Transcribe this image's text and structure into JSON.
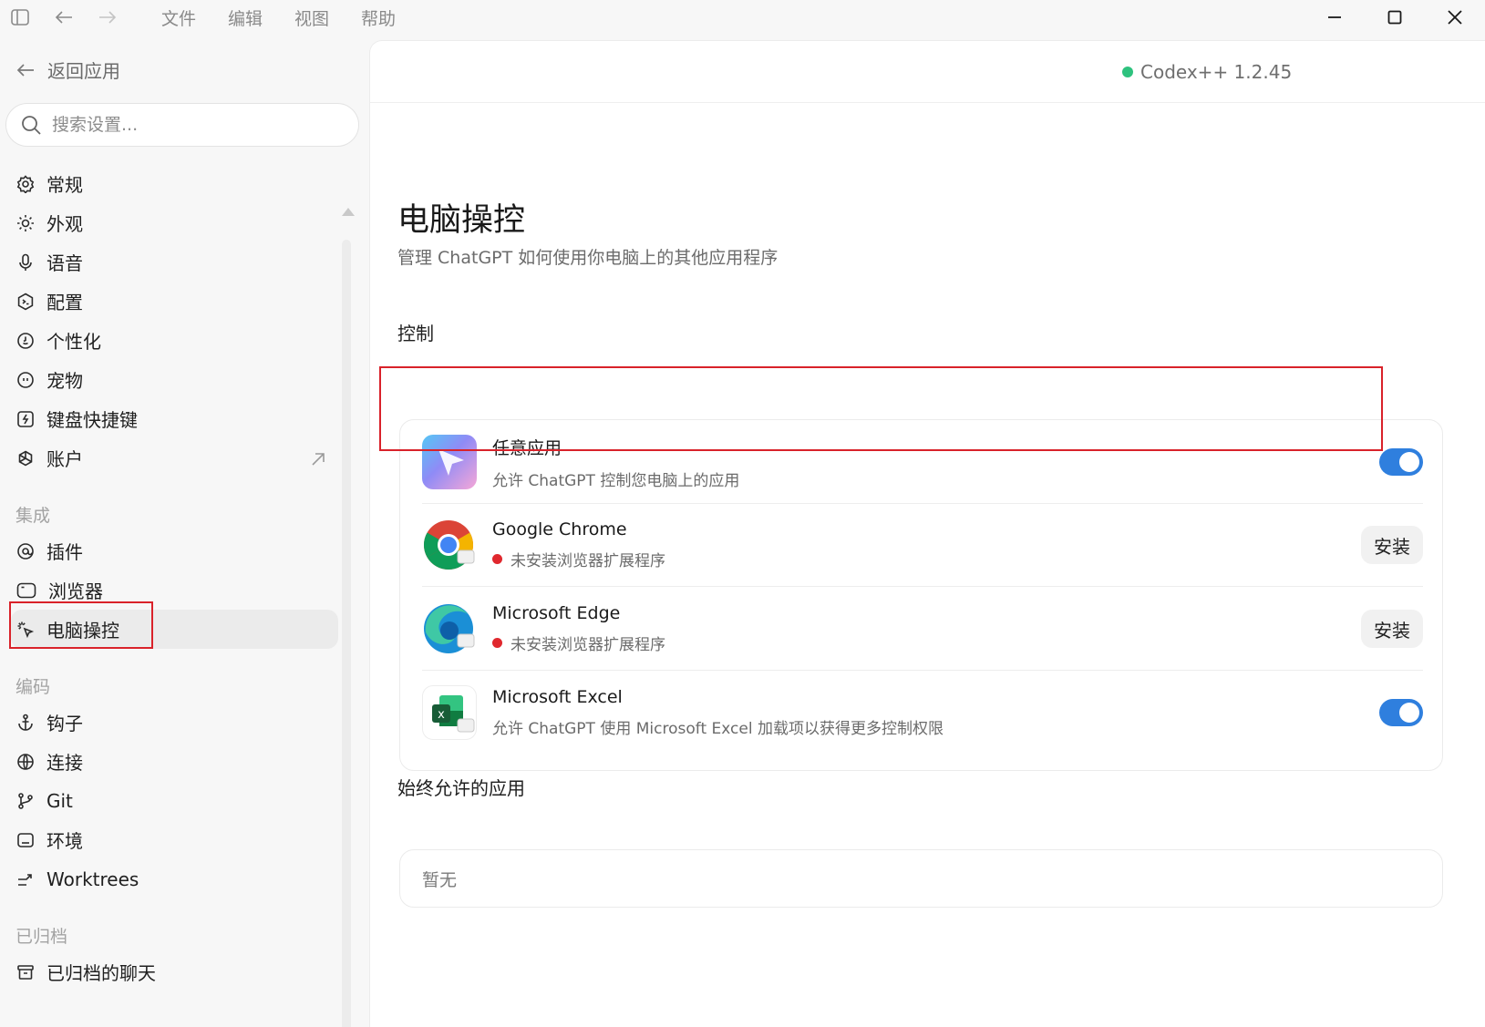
{
  "menu": {
    "items": [
      "文件",
      "编辑",
      "视图",
      "帮助"
    ]
  },
  "sidebar": {
    "back_label": "返回应用",
    "search_placeholder": "搜索设置...",
    "general": [
      {
        "label": "常规",
        "icon": "gear-icon"
      },
      {
        "label": "外观",
        "icon": "sun-icon"
      },
      {
        "label": "语音",
        "icon": "microphone-icon"
      },
      {
        "label": "配置",
        "icon": "terminal-hexagon-icon"
      },
      {
        "label": "个性化",
        "icon": "personalization-icon"
      },
      {
        "label": "宠物",
        "icon": "pet-icon"
      },
      {
        "label": "键盘快捷键",
        "icon": "keyboard-shortcut-icon"
      },
      {
        "label": "账户",
        "icon": "openai-logo-icon"
      }
    ],
    "integration_label": "集成",
    "integration": [
      {
        "label": "插件",
        "icon": "plugin-icon"
      },
      {
        "label": "浏览器",
        "icon": "browser-icon"
      },
      {
        "label": "电脑操控",
        "icon": "cursor-click-icon"
      }
    ],
    "coding_label": "编码",
    "coding": [
      {
        "label": "钩子",
        "icon": "anchor-icon"
      },
      {
        "label": "连接",
        "icon": "globe-icon"
      },
      {
        "label": "Git",
        "icon": "git-branch-icon"
      },
      {
        "label": "环境",
        "icon": "environment-icon"
      },
      {
        "label": "Worktrees",
        "icon": "worktree-icon"
      }
    ],
    "archived_label": "已归档",
    "archived": [
      {
        "label": "已归档的聊天",
        "icon": "archive-icon"
      }
    ]
  },
  "header": {
    "version": "Codex++ 1.2.45"
  },
  "page": {
    "title": "电脑操控",
    "subtitle": "管理 ChatGPT 如何使用你电脑上的其他应用程序",
    "control_title": "控制",
    "apps": [
      {
        "name": "任意应用",
        "desc": "允许 ChatGPT 控制您电脑上的应用",
        "action": "toggle-on",
        "icon": "any-app-icon"
      },
      {
        "name": "Google Chrome",
        "desc": "未安装浏览器扩展程序",
        "action": "安装",
        "status": "red",
        "icon": "chrome-icon"
      },
      {
        "name": "Microsoft Edge",
        "desc": "未安装浏览器扩展程序",
        "action": "安装",
        "status": "red",
        "icon": "edge-icon"
      },
      {
        "name": "Microsoft Excel",
        "desc": "允许 ChatGPT 使用 Microsoft Excel 加载项以获得更多控制权限",
        "action": "toggle-on",
        "icon": "excel-icon"
      }
    ],
    "always_allowed_title": "始终允许的应用",
    "always_allowed_empty": "暂无"
  },
  "colors": {
    "accent": "#2f7fde",
    "highlight": "#d9222a",
    "status_green": "#2ec27e",
    "status_red": "#e0282e"
  }
}
